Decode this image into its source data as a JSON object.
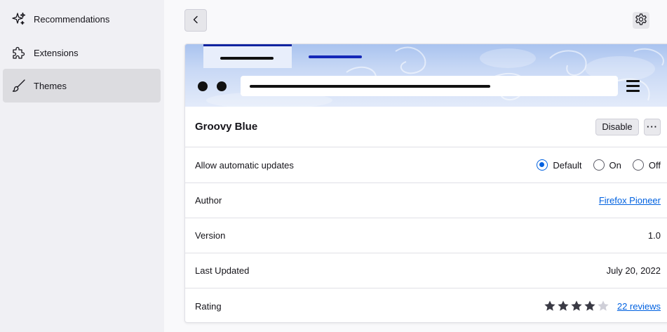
{
  "sidebar": {
    "items": [
      {
        "label": "Recommendations",
        "icon": "sparkle-icon"
      },
      {
        "label": "Extensions",
        "icon": "puzzle-icon"
      },
      {
        "label": "Themes",
        "icon": "brush-icon",
        "selected": true
      }
    ]
  },
  "header": {
    "back_icon": "back-icon",
    "settings_icon": "gear-icon"
  },
  "addon": {
    "name": "Groovy Blue",
    "disable_label": "Disable",
    "more_label": "···",
    "updates_label": "Allow automatic updates",
    "updates_options": [
      "Default",
      "On",
      "Off"
    ],
    "updates_selected": "Default",
    "author_label": "Author",
    "author_value": "Firefox Pioneer",
    "version_label": "Version",
    "version_value": "1.0",
    "updated_label": "Last Updated",
    "updated_value": "July 20, 2022",
    "rating_label": "Rating",
    "rating_value": 4,
    "rating_max": 5,
    "reviews_label": "22 reviews"
  },
  "colors": {
    "accent": "#0061e0",
    "theme_tab": "#1024a0",
    "theme_bg": "#a9c3ef"
  }
}
